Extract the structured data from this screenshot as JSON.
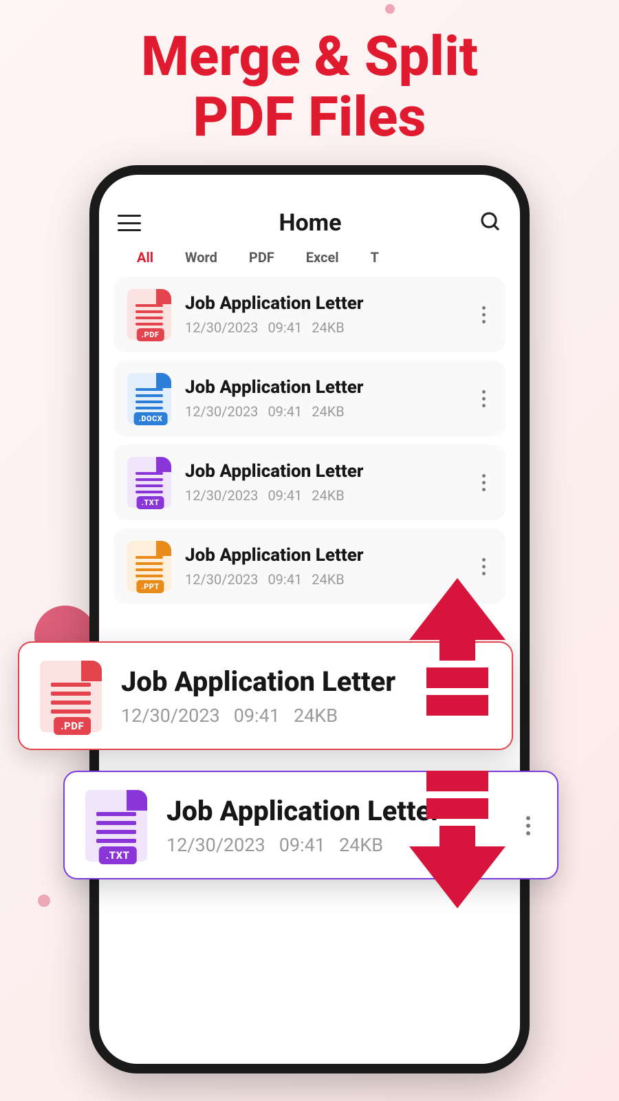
{
  "headline": {
    "l1": "Merge & Split",
    "l2": "PDF Files"
  },
  "header": {
    "title": "Home"
  },
  "tabs": [
    {
      "label": "All",
      "active": true
    },
    {
      "label": "Word",
      "active": false
    },
    {
      "label": "PDF",
      "active": false
    },
    {
      "label": "Excel",
      "active": false
    },
    {
      "label": "T",
      "active": false
    }
  ],
  "files": [
    {
      "type": "pdf",
      "badge": ".PDF",
      "title": "Job Application Letter",
      "date": "12/30/2023",
      "time": "09:41",
      "size": "24KB"
    },
    {
      "type": "docx",
      "badge": ".DOCX",
      "title": "Job Application Letter",
      "date": "12/30/2023",
      "time": "09:41",
      "size": "24KB"
    },
    {
      "type": "txt",
      "badge": ".TXT",
      "title": "Job Application Letter",
      "date": "12/30/2023",
      "time": "09:41",
      "size": "24KB"
    },
    {
      "type": "ppt",
      "badge": ".PPT",
      "title": "Job Application Letter",
      "date": "12/30/2023",
      "time": "09:41",
      "size": "24KB"
    }
  ],
  "highlight": [
    {
      "type": "pdf",
      "badge": ".PDF",
      "title": "Job Application Letter",
      "date": "12/30/2023",
      "time": "09:41",
      "size": "24KB"
    },
    {
      "type": "txt",
      "badge": ".TXT",
      "title": "Job Application Letter",
      "date": "12/30/2023",
      "time": "09:41",
      "size": "24KB"
    }
  ],
  "colors": {
    "accent_red": "#e01b2f",
    "pdf": "#e2434d",
    "docx": "#2d7ed8",
    "txt": "#8a35d8",
    "ppt": "#e88b1a",
    "grip": "#d6143c"
  }
}
